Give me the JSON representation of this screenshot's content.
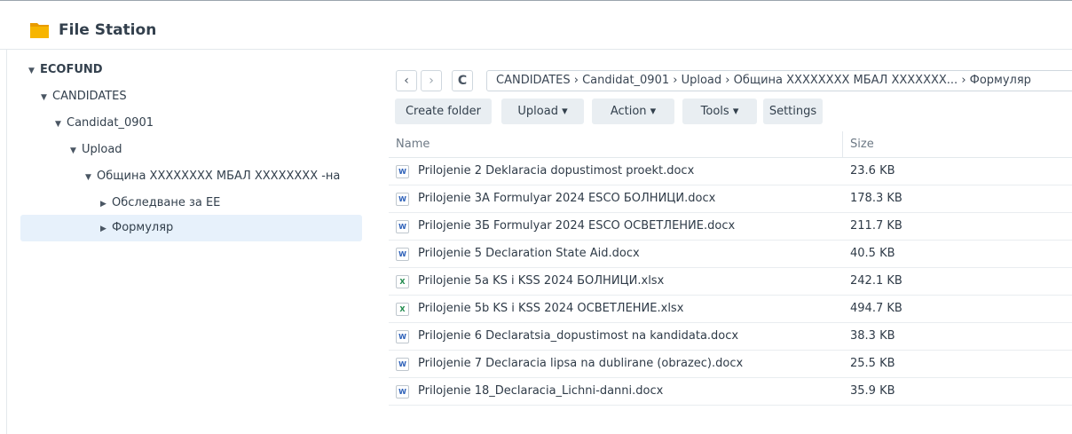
{
  "app": {
    "title": "File Station",
    "icon": "folder-icon"
  },
  "colors": {
    "accent": "#e7f1fb",
    "folder": "#f5b400",
    "word": "#2b5fb8",
    "excel": "#1f8a4c"
  },
  "sidebar": {
    "items": [
      {
        "label": "ECOFUND",
        "level": 0
      },
      {
        "label": "CANDIDATES",
        "level": 1
      },
      {
        "label": "Candidat_0901",
        "level": 2
      },
      {
        "label": "Upload",
        "level": 3
      },
      {
        "label": "Община XXXXXXXX МБАЛ XXXXXXXX -на",
        "level": 4
      },
      {
        "label": "Обследване за ЕЕ",
        "level": 5
      },
      {
        "label": "Формуляр",
        "level": 5,
        "selected": true
      }
    ]
  },
  "nav": {
    "back": "‹",
    "forward": "›",
    "refresh": "C",
    "path": "CANDIDATES › Candidat_0901 › Upload › Община XXXXXXXX МБАЛ XXXXXXX... › Формуляр"
  },
  "toolbar": {
    "create_folder": "Create folder",
    "upload": "Upload ▾",
    "action": "Action ▾",
    "tools": "Tools ▾",
    "settings": "Settings"
  },
  "table": {
    "columns": {
      "name": "Name",
      "size": "Size"
    },
    "rows": [
      {
        "name": "Prilojenie 2 Deklaracia dopustimost proekt.docx",
        "size": "23.6 KB",
        "type": "word",
        "icon_letter": "W"
      },
      {
        "name": "Prilojenie 3A Formulyar 2024 ESCO БОЛНИЦИ.docx",
        "size": "178.3 KB",
        "type": "word",
        "icon_letter": "W"
      },
      {
        "name": "Prilojenie 3Б Formulyar 2024 ESCO ОСВЕТЛЕНИЕ.docx",
        "size": "211.7 KB",
        "type": "word",
        "icon_letter": "W"
      },
      {
        "name": "Prilojenie 5 Declaration State Aid.docx",
        "size": "40.5 KB",
        "type": "word",
        "icon_letter": "W"
      },
      {
        "name": "Prilojenie 5a KS i KSS 2024 БОЛНИЦИ.xlsx",
        "size": "242.1 KB",
        "type": "excel",
        "icon_letter": "X"
      },
      {
        "name": "Prilojenie 5b KS i KSS 2024 ОСВЕТЛЕНИЕ.xlsx",
        "size": "494.7 KB",
        "type": "excel",
        "icon_letter": "X"
      },
      {
        "name": "Prilojenie 6 Declaratsia_dopustimost na kandidata.docx",
        "size": "38.3 KB",
        "type": "word",
        "icon_letter": "W"
      },
      {
        "name": "Prilojenie 7 Declaracia lipsa na dublirane (obrazec).docx",
        "size": "25.5 KB",
        "type": "word",
        "icon_letter": "W"
      },
      {
        "name": "Prilojenie 18_Declaracia_Lichni-danni.docx",
        "size": "35.9 KB",
        "type": "word",
        "icon_letter": "W"
      }
    ]
  }
}
